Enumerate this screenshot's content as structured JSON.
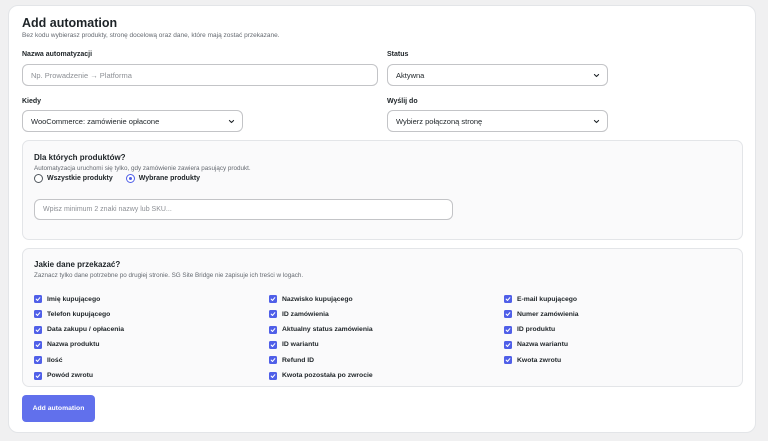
{
  "header": {
    "title": "Add automation",
    "subtitle": "Bez kodu wybierasz produkty, stronę docelową oraz dane, które mają zostać przekazane."
  },
  "form": {
    "name_label": "Nazwa automatyzacji",
    "name_placeholder": "Np. Prowadzenie → Platforma",
    "status_label": "Status",
    "status_value": "Aktywna",
    "when_label": "Kiedy",
    "when_value": "WooCommerce: zamówienie opłacone",
    "send_to_label": "Wyślij do",
    "send_to_value": "Wybierz połączoną stronę"
  },
  "products_section": {
    "title": "Dla których produktów?",
    "subtitle": "Automatyzacja uruchomi się tylko, gdy zamówienie zawiera pasujący produkt.",
    "radio_all": "Wszystkie produkty",
    "radio_selected": "Wybrane produkty",
    "selected_option": "Wybrane produkty",
    "search_placeholder": "Wpisz minimum 2 znaki nazwy lub SKU..."
  },
  "data_section": {
    "title": "Jakie dane przekazać?",
    "subtitle": "Zaznacz tylko dane potrzebne po drugiej stronie. SG Site Bridge nie zapisuje ich treści w logach.",
    "fields": [
      "Imię kupującego",
      "Nazwisko kupującego",
      "E-mail kupującego",
      "Telefon kupującego",
      "ID zamówienia",
      "Numer zamówienia",
      "Data zakupu / opłacenia",
      "Aktualny status zamówienia",
      "ID produktu",
      "Nazwa produktu",
      "ID wariantu",
      "Nazwa wariantu",
      "Ilość",
      "Refund ID",
      "Kwota zwrotu",
      "Powód zwrotu",
      "Kwota pozostała po zwrocie"
    ],
    "checked": true
  },
  "actions": {
    "add_label": "Add automation"
  },
  "colors": {
    "accent": "#4f5fe8",
    "button": "#6170ec",
    "background": "#f0f0f1"
  }
}
